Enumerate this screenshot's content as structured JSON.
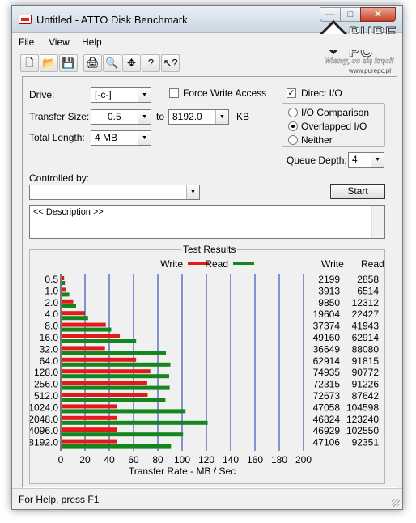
{
  "window": {
    "title": "Untitled - ATTO Disk Benchmark",
    "buttons": {
      "minimize": "—",
      "maximize": "□",
      "close": "✕"
    }
  },
  "watermark": {
    "brand": "PURE PC",
    "slogan": "Wiemy, co się kręci!",
    "url": "www.purepc.pl"
  },
  "menu": [
    "File",
    "View",
    "Help"
  ],
  "toolbar": {
    "icons": [
      "new-icon",
      "open-icon",
      "save-icon",
      "print-icon",
      "print-preview-icon",
      "move-icon",
      "help-icon",
      "context-help-icon"
    ],
    "glyphs": [
      "🗋",
      "📂",
      "💾",
      "🖨",
      "🔍",
      "✥",
      "?",
      "↖?"
    ]
  },
  "settings": {
    "drive_label": "Drive:",
    "drive_value": "[-c-]",
    "force_write_label": "Force Write Access",
    "force_write_checked": false,
    "direct_io_label": "Direct I/O",
    "direct_io_checked": true,
    "transfer_size_label": "Transfer Size:",
    "transfer_from": "0.5",
    "to_label": "to",
    "transfer_to": "8192.0",
    "kb_label": "KB",
    "total_length_label": "Total Length:",
    "total_length_value": "4 MB",
    "io_options": [
      {
        "label": "I/O Comparison",
        "selected": false
      },
      {
        "label": "Overlapped I/O",
        "selected": true
      },
      {
        "label": "Neither",
        "selected": false
      }
    ],
    "queue_depth_label": "Queue Depth:",
    "queue_depth_value": "4",
    "controlled_by_label": "Controlled by:",
    "controlled_by_value": "",
    "start_label": "Start",
    "description": "<< Description >>"
  },
  "results": {
    "group_title": "Test Results",
    "legend_write": "Write",
    "legend_read": "Read",
    "col_write": "Write",
    "col_read": "Read",
    "write_color": "#e21a1a",
    "read_color": "#15861e",
    "grid_color": "#1a2fb6"
  },
  "chart_data": {
    "type": "bar",
    "orientation": "horizontal",
    "categories": [
      "0.5",
      "1.0",
      "2.0",
      "4.0",
      "8.0",
      "16.0",
      "32.0",
      "64.0",
      "128.0",
      "256.0",
      "512.0",
      "1024.0",
      "2048.0",
      "4096.0",
      "8192.0"
    ],
    "series": [
      {
        "name": "Write",
        "values": [
          2199,
          3913,
          9850,
          19604,
          37374,
          49160,
          36649,
          62914,
          74935,
          72315,
          72673,
          47058,
          46824,
          46929,
          47106
        ]
      },
      {
        "name": "Read",
        "values": [
          2858,
          6514,
          12312,
          22427,
          41943,
          62914,
          88080,
          91815,
          90772,
          91226,
          87642,
          104598,
          123240,
          102550,
          92351
        ]
      }
    ],
    "xlabel": "Transfer Rate - MB / Sec",
    "xlim": [
      0,
      200
    ],
    "xticks": [
      "0",
      "20",
      "40",
      "60",
      "80",
      "100",
      "120",
      "140",
      "160",
      "180",
      "200"
    ],
    "legend": "top-center",
    "grid": true
  },
  "status": {
    "text": "For Help, press F1"
  }
}
